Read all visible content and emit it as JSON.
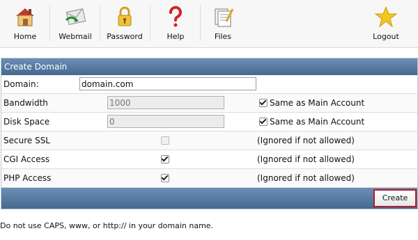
{
  "toolbar": {
    "items": [
      {
        "label": "Home",
        "icon": "home-icon"
      },
      {
        "label": "Webmail",
        "icon": "webmail-icon"
      },
      {
        "label": "Password",
        "icon": "padlock-icon"
      },
      {
        "label": "Help",
        "icon": "question-mark-icon"
      },
      {
        "label": "Files",
        "icon": "files-icon"
      },
      {
        "label": "Logout",
        "icon": "star-icon"
      }
    ]
  },
  "panel": {
    "title": "Create Domain",
    "rows": [
      {
        "label": "Domain:",
        "value": "domain.com"
      },
      {
        "label": "Bandwidth",
        "value": "1000",
        "note": "Same as Main Account",
        "checked": true
      },
      {
        "label": "Disk Space",
        "value": "0",
        "note": "Same as Main Account",
        "checked": true
      },
      {
        "label": "Secure SSL",
        "note": "(Ignored if not allowed)",
        "checked": false
      },
      {
        "label": "CGI Access",
        "note": "(Ignored if not allowed)",
        "checked": true
      },
      {
        "label": "PHP Access",
        "note": "(Ignored if not allowed)",
        "checked": true
      }
    ],
    "create_label": "Create"
  },
  "note": "Do not use CAPS, www, or http:// in your domain name.",
  "colors": {
    "header_blue": "#4f74a0",
    "create_border": "#b51b2b"
  }
}
